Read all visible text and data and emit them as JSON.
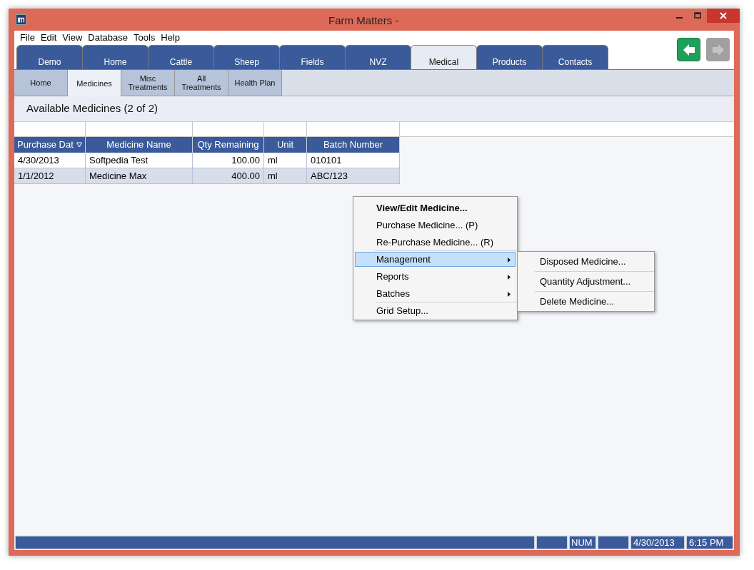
{
  "window": {
    "title": "Farm Matters -"
  },
  "menu_bar": [
    "File",
    "Edit",
    "View",
    "Database",
    "Tools",
    "Help"
  ],
  "tabs": [
    {
      "label": "Demo",
      "selected": false
    },
    {
      "label": "Home",
      "selected": false
    },
    {
      "label": "Cattle",
      "selected": false
    },
    {
      "label": "Sheep",
      "selected": false
    },
    {
      "label": "Fields",
      "selected": false
    },
    {
      "label": "NVZ",
      "selected": false
    },
    {
      "label": "Medical",
      "selected": true
    },
    {
      "label": "Products",
      "selected": false
    },
    {
      "label": "Contacts",
      "selected": false
    }
  ],
  "nav_buttons": [
    {
      "kind": "back",
      "disabled": false
    },
    {
      "kind": "forward",
      "disabled": true
    }
  ],
  "sub_tabs": [
    {
      "label": "Home",
      "selected": false
    },
    {
      "label": "Medicines",
      "selected": true
    },
    {
      "label": "Misc\nTreatments",
      "selected": false
    },
    {
      "label": "All\nTreatments",
      "selected": false
    },
    {
      "label": "Health Plan",
      "selected": false
    }
  ],
  "heading": "Available Medicines (2 of 2)",
  "table": {
    "columns": [
      {
        "label": "Purchase Dat",
        "sorted": true,
        "kind": "text"
      },
      {
        "label": "Medicine Name",
        "sorted": false,
        "kind": "text"
      },
      {
        "label": "Qty Remaining",
        "sorted": false,
        "kind": "number"
      },
      {
        "label": "Unit",
        "sorted": false,
        "kind": "text"
      },
      {
        "label": "Batch Number",
        "sorted": false,
        "kind": "text"
      }
    ],
    "rows": [
      [
        "4/30/2013",
        "Softpedia Test",
        "100.00",
        "ml",
        "010101"
      ],
      [
        "1/1/2012",
        "Medicine Max",
        "400.00",
        "ml",
        "ABC/123"
      ]
    ]
  },
  "context_menu": {
    "items": [
      {
        "label": "View/Edit Medicine...",
        "default": true,
        "submenu": false,
        "selected": false,
        "separator_before": false
      },
      {
        "label": "Purchase Medicine... (P)",
        "default": false,
        "submenu": false,
        "selected": false,
        "separator_before": false
      },
      {
        "label": "Re-Purchase Medicine... (R)",
        "default": false,
        "submenu": false,
        "selected": false,
        "separator_before": false
      },
      {
        "label": "Management",
        "default": false,
        "submenu": true,
        "selected": true,
        "separator_before": true
      },
      {
        "label": "Reports",
        "default": false,
        "submenu": true,
        "selected": false,
        "separator_before": false
      },
      {
        "label": "Batches",
        "default": false,
        "submenu": true,
        "selected": false,
        "separator_before": false
      },
      {
        "label": "Grid Setup...",
        "default": false,
        "submenu": false,
        "selected": false,
        "separator_before": true
      }
    ],
    "submenu": [
      "Disposed Medicine...",
      "Quantity Adjustment...",
      "Delete Medicine..."
    ]
  },
  "status_bar": {
    "indicator": "NUM",
    "date": "4/30/2013",
    "time": "6:15 PM"
  }
}
